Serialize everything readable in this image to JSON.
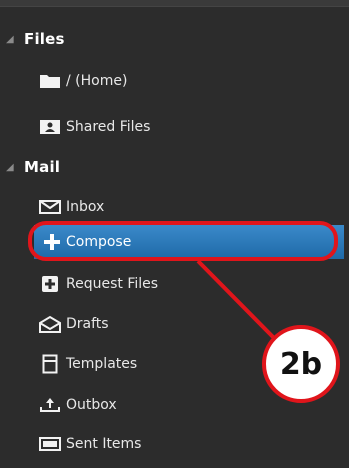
{
  "sidebar": {
    "files": {
      "header": "Files",
      "items": [
        {
          "label": "/ (Home)",
          "icon": "folder-icon"
        },
        {
          "label": "Shared Files",
          "icon": "shared-files-icon"
        }
      ]
    },
    "mail": {
      "header": "Mail",
      "items": [
        {
          "label": "Inbox",
          "icon": "envelope-icon"
        },
        {
          "label": "Compose",
          "icon": "plus-icon",
          "selected": true
        },
        {
          "label": "Request Files",
          "icon": "request-files-icon"
        },
        {
          "label": "Drafts",
          "icon": "drafts-icon"
        },
        {
          "label": "Templates",
          "icon": "templates-icon"
        },
        {
          "label": "Outbox",
          "icon": "outbox-icon"
        },
        {
          "label": "Sent Items",
          "icon": "sent-items-icon"
        }
      ]
    }
  },
  "annotation": {
    "badge_text": "2b",
    "color": "#e0151b"
  },
  "colors": {
    "background": "#2c2c2c",
    "selected": "#2b78b8",
    "text": "#e8e8e8"
  }
}
